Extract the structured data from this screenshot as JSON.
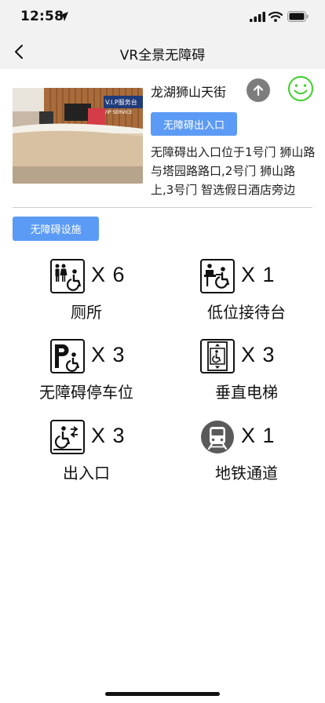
{
  "status": {
    "time": "12:58"
  },
  "nav": {
    "title": "VR全景无障碍"
  },
  "station": {
    "name": "龙湖狮山天街",
    "entrance_label": "无障碍出入口",
    "description": "无障碍出入口位于1号门 狮山路与塔园路路口,2号门 狮山路上,3号门 智选假日酒店旁边",
    "photo_sign": "V.I.P服务台",
    "photo_sign_en": "VIP SERVICE"
  },
  "facilities_label": "无障碍设施",
  "facilities": [
    {
      "name": "厕所",
      "count": "X 6",
      "icon": "accessible-toilet-icon"
    },
    {
      "name": "低位接待台",
      "count": "X 1",
      "icon": "low-reception-desk-icon"
    },
    {
      "name": "无障碍停车位",
      "count": "X 3",
      "icon": "accessible-parking-icon"
    },
    {
      "name": "垂直电梯",
      "count": "X 3",
      "icon": "accessible-elevator-icon"
    },
    {
      "name": "出入口",
      "count": "X 3",
      "icon": "accessible-entrance-icon"
    },
    {
      "name": "地铁通道",
      "count": "X 1",
      "icon": "metro-passage-icon"
    }
  ],
  "colors": {
    "accent": "#5b9bf5",
    "smile": "#4cd137",
    "bar": "#f2f2f2"
  }
}
